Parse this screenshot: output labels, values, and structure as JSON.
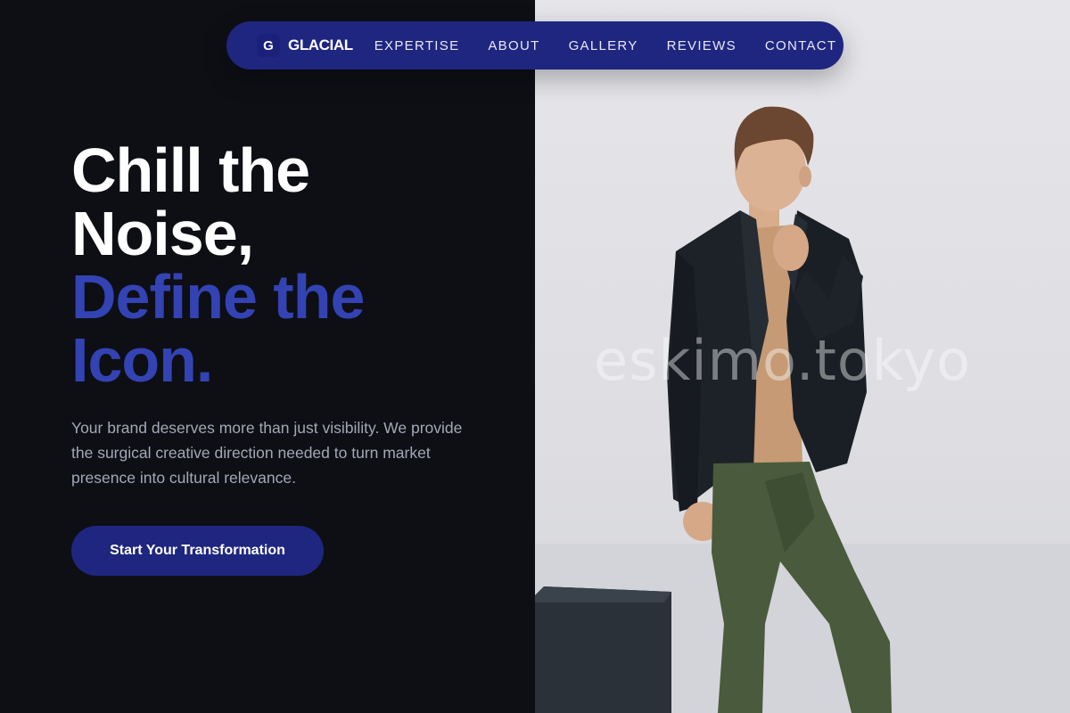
{
  "nav": {
    "brand_mark": "G",
    "brand_name": "GLACIAL",
    "links": [
      "EXPERTISE",
      "ABOUT",
      "GALLERY",
      "REVIEWS",
      "CONTACT"
    ]
  },
  "hero": {
    "title_line1": "Chill the",
    "title_line2": "Noise,",
    "title_line3": "Define the",
    "title_line4": "Icon.",
    "description": "Your brand deserves more than just visibility. We provide the surgical creative direction needed to turn market presence into cultural relevance.",
    "cta_label": "Start Your Transformation"
  },
  "photo": {
    "watermark": "eskimo.tokyo"
  },
  "colors": {
    "background": "#0d0f15",
    "accent": "#3443b3",
    "nav": "#1f2680",
    "body_text": "#a4a8b6"
  }
}
